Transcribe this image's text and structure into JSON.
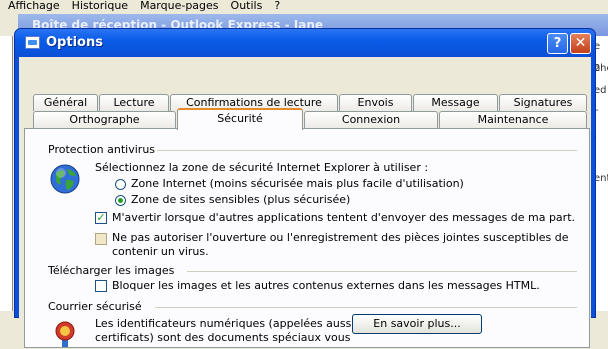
{
  "background_app": {
    "menu": [
      "Affichage",
      "Historique",
      "Marque-pages",
      "Outils",
      "?"
    ],
    "window_title": "Boîte de réception - Outlook Express - Jane",
    "right_fragments": [
      "e 2",
      "oho",
      "ed",
      "r",
      ".",
      "",
      "ent"
    ]
  },
  "dialog": {
    "title": "Options",
    "help_label": "?",
    "close_label": "✕"
  },
  "tabs_row1": [
    "Général",
    "Lecture",
    "Confirmations de lecture",
    "Envois",
    "Message",
    "Signatures"
  ],
  "tabs_row2": [
    "Orthographe",
    "Sécurité",
    "Connexion",
    "Maintenance"
  ],
  "active_tab": "Sécurité",
  "antivirus": {
    "heading": "Protection antivirus",
    "zone_prompt": "Sélectionnez la zone de sécurité Internet Explorer à utiliser :",
    "zone_internet": "Zone Internet (moins sécurisée mais plus facile d'utilisation)",
    "zone_restricted": "Zone de sites sensibles (plus sécurisée)",
    "selected_zone": "Zone de sites sensibles (plus sécurisée)",
    "warn_label": "M'avertir lorsque d'autres applications tentent d'envoyer des messages de ma part.",
    "warn_checked": true,
    "block_attach_line1": "Ne pas autoriser l'ouverture ou l'enregistrement des pièces jointes susceptibles de",
    "block_attach_line2": "contenir un virus.",
    "block_attach_checked": false
  },
  "images": {
    "heading": "Télécharger les images",
    "block_images_label": "Bloquer les images et les autres contenus externes dans les messages HTML.",
    "block_images_checked": false
  },
  "secure_mail": {
    "heading": "Courrier sécurisé",
    "text_line1": "Les identificateurs numériques (appelées aussi",
    "text_line2": "certificats) sont des documents spéciaux vous",
    "learn_more_label": "En savoir plus..."
  }
}
